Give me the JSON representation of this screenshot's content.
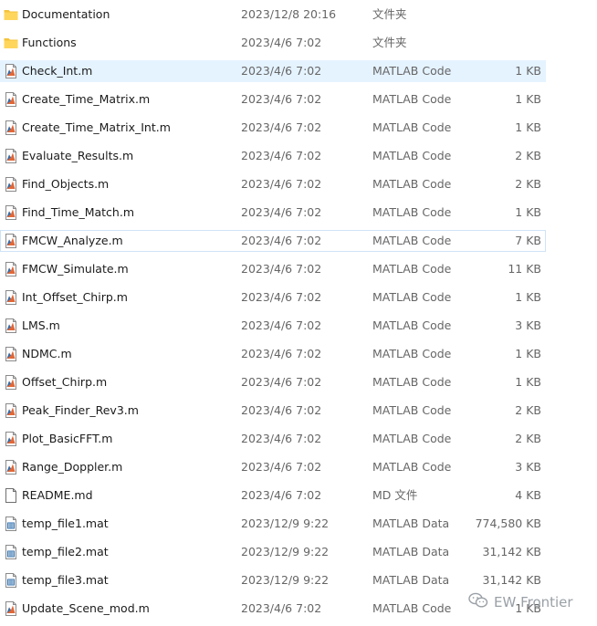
{
  "files": [
    {
      "name": "Documentation",
      "date": "2023/12/8 20:16",
      "type": "文件夹",
      "size": "",
      "icon": "folder-icon"
    },
    {
      "name": "Functions",
      "date": "2023/4/6 7:02",
      "type": "文件夹",
      "size": "",
      "icon": "folder-icon"
    },
    {
      "name": "Check_Int.m",
      "date": "2023/4/6 7:02",
      "type": "MATLAB Code",
      "size": "1 KB",
      "icon": "matlab-code-file-icon",
      "state": "selected"
    },
    {
      "name": "Create_Time_Matrix.m",
      "date": "2023/4/6 7:02",
      "type": "MATLAB Code",
      "size": "1 KB",
      "icon": "matlab-code-file-icon"
    },
    {
      "name": "Create_Time_Matrix_Int.m",
      "date": "2023/4/6 7:02",
      "type": "MATLAB Code",
      "size": "1 KB",
      "icon": "matlab-code-file-icon"
    },
    {
      "name": "Evaluate_Results.m",
      "date": "2023/4/6 7:02",
      "type": "MATLAB Code",
      "size": "2 KB",
      "icon": "matlab-code-file-icon"
    },
    {
      "name": "Find_Objects.m",
      "date": "2023/4/6 7:02",
      "type": "MATLAB Code",
      "size": "2 KB",
      "icon": "matlab-code-file-icon"
    },
    {
      "name": "Find_Time_Match.m",
      "date": "2023/4/6 7:02",
      "type": "MATLAB Code",
      "size": "1 KB",
      "icon": "matlab-code-file-icon"
    },
    {
      "name": "FMCW_Analyze.m",
      "date": "2023/4/6 7:02",
      "type": "MATLAB Code",
      "size": "7 KB",
      "icon": "matlab-code-file-icon",
      "state": "focused"
    },
    {
      "name": "FMCW_Simulate.m",
      "date": "2023/4/6 7:02",
      "type": "MATLAB Code",
      "size": "11 KB",
      "icon": "matlab-code-file-icon"
    },
    {
      "name": "Int_Offset_Chirp.m",
      "date": "2023/4/6 7:02",
      "type": "MATLAB Code",
      "size": "1 KB",
      "icon": "matlab-code-file-icon"
    },
    {
      "name": "LMS.m",
      "date": "2023/4/6 7:02",
      "type": "MATLAB Code",
      "size": "3 KB",
      "icon": "matlab-code-file-icon"
    },
    {
      "name": "NDMC.m",
      "date": "2023/4/6 7:02",
      "type": "MATLAB Code",
      "size": "1 KB",
      "icon": "matlab-code-file-icon"
    },
    {
      "name": "Offset_Chirp.m",
      "date": "2023/4/6 7:02",
      "type": "MATLAB Code",
      "size": "1 KB",
      "icon": "matlab-code-file-icon"
    },
    {
      "name": "Peak_Finder_Rev3.m",
      "date": "2023/4/6 7:02",
      "type": "MATLAB Code",
      "size": "2 KB",
      "icon": "matlab-code-file-icon"
    },
    {
      "name": "Plot_BasicFFT.m",
      "date": "2023/4/6 7:02",
      "type": "MATLAB Code",
      "size": "2 KB",
      "icon": "matlab-code-file-icon"
    },
    {
      "name": "Range_Doppler.m",
      "date": "2023/4/6 7:02",
      "type": "MATLAB Code",
      "size": "3 KB",
      "icon": "matlab-code-file-icon"
    },
    {
      "name": "README.md",
      "date": "2023/4/6 7:02",
      "type": "MD 文件",
      "size": "4 KB",
      "icon": "document-file-icon"
    },
    {
      "name": "temp_file1.mat",
      "date": "2023/12/9 9:22",
      "type": "MATLAB Data",
      "size": "774,580 KB",
      "icon": "matlab-data-file-icon"
    },
    {
      "name": "temp_file2.mat",
      "date": "2023/12/9 9:22",
      "type": "MATLAB Data",
      "size": "31,142 KB",
      "icon": "matlab-data-file-icon"
    },
    {
      "name": "temp_file3.mat",
      "date": "2023/12/9 9:22",
      "type": "MATLAB Data",
      "size": "31,142 KB",
      "icon": "matlab-data-file-icon"
    },
    {
      "name": "Update_Scene_mod.m",
      "date": "2023/4/6 7:02",
      "type": "MATLAB Code",
      "size": "1 KB",
      "icon": "matlab-code-file-icon"
    }
  ],
  "watermark": {
    "text": "EW Frontier",
    "icon": "wechat-icon"
  },
  "colors": {
    "selected_background": "#e5f3ff",
    "focused_border": "#cfe3f7",
    "folder_yellow": "#f4c33b",
    "matlab_orange": "#e16737",
    "secondary_text": "#666666"
  }
}
